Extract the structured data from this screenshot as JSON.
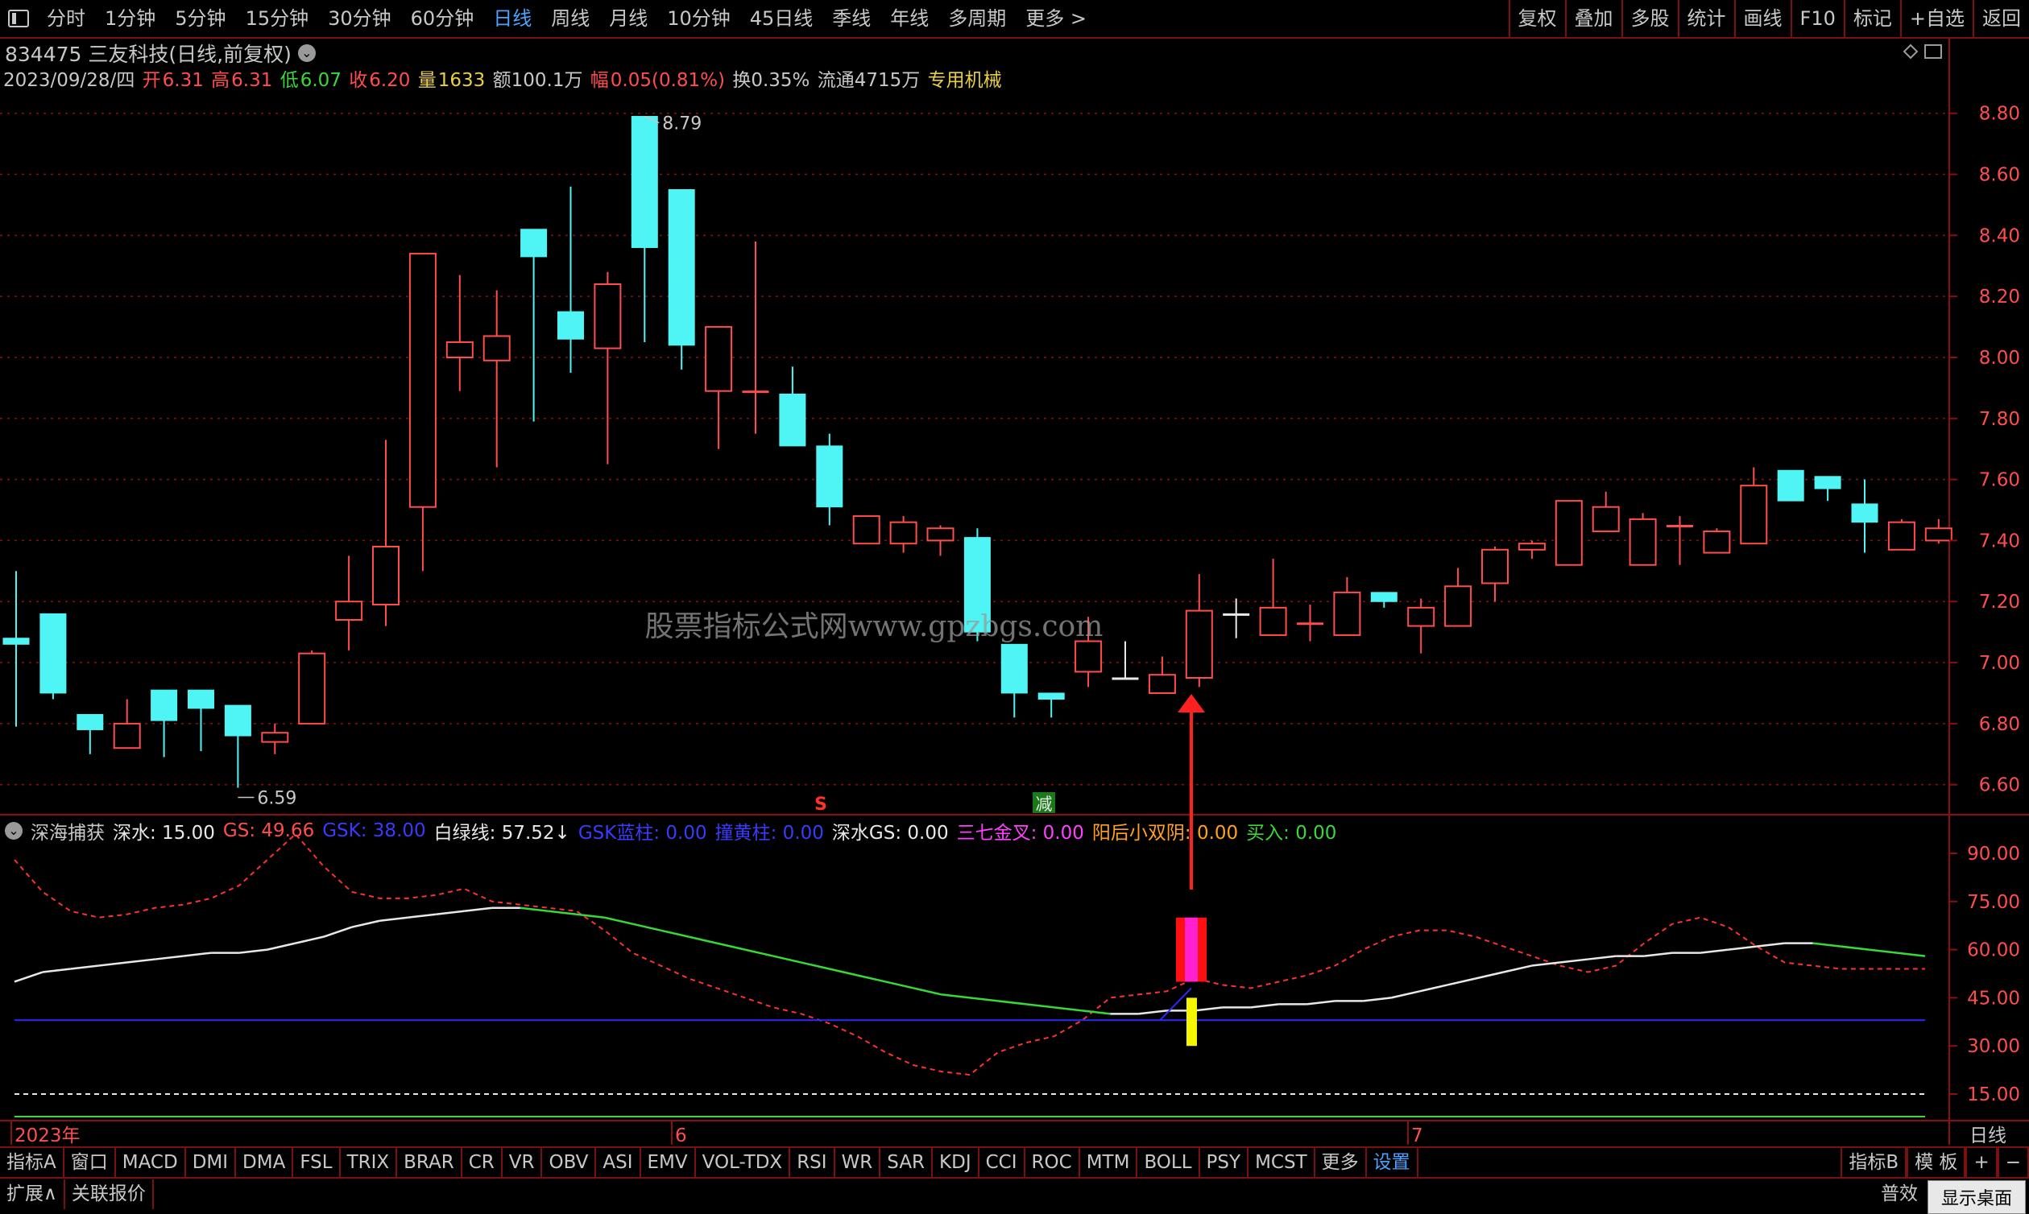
{
  "colors": {
    "up": "#ff4d4d",
    "down": "#4ff5f5",
    "grid": "#8a1010",
    "white": "#e8e8e8",
    "green": "#38d838",
    "blue": "#2a2aff"
  },
  "topbar": {
    "items": [
      "分时",
      "1分钟",
      "5分钟",
      "15分钟",
      "30分钟",
      "60分钟",
      "日线",
      "周线",
      "月线",
      "10分钟",
      "45日线",
      "季线",
      "年线",
      "多周期",
      "更多 >"
    ],
    "active_index": 6,
    "right_items": [
      "复权",
      "叠加",
      "多股",
      "统计",
      "画线",
      "F10",
      "标记",
      "+自选",
      "返回"
    ]
  },
  "stock": {
    "code_name": "834475 三友科技(日线,前复权)"
  },
  "info": {
    "date": "2023/09/28/四",
    "open_label": "开",
    "open": "6.31",
    "high_label": "高",
    "high": "6.31",
    "low_label": "低",
    "low": "6.07",
    "close_label": "收",
    "close": "6.20",
    "vol_label": "量",
    "vol": "1633",
    "amt": "额100.1万",
    "chg_label": "幅",
    "chg": "0.05(0.81%)",
    "turnover": "换0.35%",
    "float": "流通4715万",
    "industry": "专用机械"
  },
  "watermark": "股票指标公式网www.gpzbgs.com",
  "price_axis": [
    "8.80",
    "8.60",
    "8.40",
    "8.20",
    "8.00",
    "7.80",
    "7.60",
    "7.40",
    "7.20",
    "7.00",
    "6.80",
    "6.60"
  ],
  "price_marks": {
    "high": "8.79",
    "low": "6.59"
  },
  "signals": {
    "s": "S",
    "jian": "减"
  },
  "indicator": {
    "name": "深海捕获",
    "shenshui": "深水: 15.00",
    "gs": "GS: 49.66",
    "gsk": "GSK: 38.00",
    "bailv": "白绿线: 57.52↓",
    "gsk_lan": "GSK蓝柱: 0.00",
    "tan_huang": "撞黄柱: 0.00",
    "shenshui_gs": "深水GS: 0.00",
    "sanqi": "三七金叉: 0.00",
    "yanghou": "阳后小双阴: 0.00",
    "mairu": "买入: 0.00",
    "axis": [
      "90.00",
      "75.00",
      "60.00",
      "45.00",
      "30.00",
      "15.00"
    ]
  },
  "time_axis": {
    "labels": [
      "2023年",
      "6",
      "7"
    ],
    "right": "日线"
  },
  "tabs": [
    "指标A",
    "窗口",
    "MACD",
    "DMI",
    "DMA",
    "FSL",
    "TRIX",
    "BRAR",
    "CR",
    "VR",
    "OBV",
    "ASI",
    "EMV",
    "VOL-TDX",
    "RSI",
    "WR",
    "SAR",
    "KDJ",
    "CCI",
    "ROC",
    "MTM",
    "BOLL",
    "PSY",
    "MCST",
    "更多",
    "设置"
  ],
  "tabs_right": [
    "指标B",
    "模 板",
    "+",
    "−"
  ],
  "bottom": {
    "expand": "扩展∧",
    "related": "关联报价",
    "desktop": "显示桌面",
    "right_cut": "普效"
  },
  "chart_data": {
    "type": "candlestick",
    "ylim": [
      6.52,
      8.86
    ],
    "candles": [
      {
        "o": 7.08,
        "c": 7.06,
        "h": 7.3,
        "l": 6.79
      },
      {
        "o": 7.16,
        "c": 6.9,
        "h": 7.16,
        "l": 6.88
      },
      {
        "o": 6.83,
        "c": 6.78,
        "h": 6.83,
        "l": 6.7
      },
      {
        "o": 6.72,
        "c": 6.8,
        "h": 6.88,
        "l": 6.72
      },
      {
        "o": 6.91,
        "c": 6.81,
        "h": 6.91,
        "l": 6.69
      },
      {
        "o": 6.91,
        "c": 6.85,
        "h": 6.91,
        "l": 6.71
      },
      {
        "o": 6.86,
        "c": 6.76,
        "h": 6.86,
        "l": 6.59
      },
      {
        "o": 6.74,
        "c": 6.77,
        "h": 6.8,
        "l": 6.7
      },
      {
        "o": 6.8,
        "c": 7.03,
        "h": 7.04,
        "l": 6.8
      },
      {
        "o": 7.14,
        "c": 7.2,
        "h": 7.35,
        "l": 7.04
      },
      {
        "o": 7.19,
        "c": 7.38,
        "h": 7.73,
        "l": 7.12
      },
      {
        "o": 7.51,
        "c": 8.34,
        "h": 8.34,
        "l": 7.3
      },
      {
        "o": 8.0,
        "c": 8.05,
        "h": 8.27,
        "l": 7.89
      },
      {
        "o": 7.99,
        "c": 8.07,
        "h": 8.22,
        "l": 7.64
      },
      {
        "o": 8.42,
        "c": 8.33,
        "h": 8.42,
        "l": 7.79
      },
      {
        "o": 8.15,
        "c": 8.06,
        "h": 8.56,
        "l": 7.95
      },
      {
        "o": 8.03,
        "c": 8.24,
        "h": 8.28,
        "l": 7.65
      },
      {
        "o": 8.79,
        "c": 8.36,
        "h": 8.79,
        "l": 8.05
      },
      {
        "o": 8.55,
        "c": 8.04,
        "h": 8.55,
        "l": 7.96
      },
      {
        "o": 7.89,
        "c": 8.1,
        "h": 8.1,
        "l": 7.7
      },
      {
        "o": 7.89,
        "c": 7.89,
        "h": 8.38,
        "l": 7.75
      },
      {
        "o": 7.88,
        "c": 7.71,
        "h": 7.97,
        "l": 7.71
      },
      {
        "o": 7.71,
        "c": 7.51,
        "h": 7.75,
        "l": 7.45
      },
      {
        "o": 7.39,
        "c": 7.48,
        "h": 7.48,
        "l": 7.39
      },
      {
        "o": 7.39,
        "c": 7.46,
        "h": 7.48,
        "l": 7.36
      },
      {
        "o": 7.4,
        "c": 7.44,
        "h": 7.45,
        "l": 7.35
      },
      {
        "o": 7.41,
        "c": 7.1,
        "h": 7.44,
        "l": 7.07
      },
      {
        "o": 7.06,
        "c": 6.9,
        "h": 7.06,
        "l": 6.82
      },
      {
        "o": 6.9,
        "c": 6.88,
        "h": 6.9,
        "l": 6.82
      },
      {
        "o": 6.97,
        "c": 7.07,
        "h": 7.15,
        "l": 6.92
      },
      {
        "o": 6.95,
        "c": 6.95,
        "h": 7.07,
        "l": 6.95
      },
      {
        "o": 6.9,
        "c": 6.96,
        "h": 7.02,
        "l": 6.9
      },
      {
        "o": 6.95,
        "c": 7.17,
        "h": 7.29,
        "l": 6.92
      },
      {
        "o": 7.16,
        "c": 7.16,
        "h": 7.21,
        "l": 7.08
      },
      {
        "o": 7.09,
        "c": 7.18,
        "h": 7.34,
        "l": 7.09
      },
      {
        "o": 7.13,
        "c": 7.13,
        "h": 7.19,
        "l": 7.07
      },
      {
        "o": 7.09,
        "c": 7.23,
        "h": 7.28,
        "l": 7.09
      },
      {
        "o": 7.23,
        "c": 7.2,
        "h": 7.23,
        "l": 7.18
      },
      {
        "o": 7.12,
        "c": 7.18,
        "h": 7.21,
        "l": 7.03
      },
      {
        "o": 7.12,
        "c": 7.25,
        "h": 7.31,
        "l": 7.12
      },
      {
        "o": 7.26,
        "c": 7.37,
        "h": 7.38,
        "l": 7.2
      },
      {
        "o": 7.37,
        "c": 7.39,
        "h": 7.4,
        "l": 7.34
      },
      {
        "o": 7.32,
        "c": 7.53,
        "h": 7.53,
        "l": 7.32
      },
      {
        "o": 7.43,
        "c": 7.51,
        "h": 7.56,
        "l": 7.43
      },
      {
        "o": 7.32,
        "c": 7.47,
        "h": 7.49,
        "l": 7.32
      },
      {
        "o": 7.45,
        "c": 7.45,
        "h": 7.48,
        "l": 7.32
      },
      {
        "o": 7.36,
        "c": 7.43,
        "h": 7.44,
        "l": 7.36
      },
      {
        "o": 7.39,
        "c": 7.58,
        "h": 7.64,
        "l": 7.39
      },
      {
        "o": 7.63,
        "c": 7.53,
        "h": 7.63,
        "l": 7.53
      },
      {
        "o": 7.61,
        "c": 7.57,
        "h": 7.61,
        "l": 7.53
      },
      {
        "o": 7.52,
        "c": 7.46,
        "h": 7.6,
        "l": 7.36
      },
      {
        "o": 7.37,
        "c": 7.46,
        "h": 7.47,
        "l": 7.37
      },
      {
        "o": 7.4,
        "c": 7.44,
        "h": 7.47,
        "l": 7.39
      }
    ],
    "indicator_ylim": [
      0,
      100
    ],
    "white_green_line": [
      50,
      53,
      54,
      55,
      56,
      57,
      58,
      59,
      59,
      60,
      62,
      64,
      67,
      69,
      70,
      71,
      72,
      73,
      73,
      72,
      71,
      70,
      68,
      66,
      64,
      62,
      60,
      58,
      56,
      54,
      52,
      50,
      48,
      46,
      45,
      44,
      43,
      42,
      41,
      40,
      40,
      41,
      41,
      42,
      42,
      43,
      43,
      44,
      44,
      45,
      47,
      49,
      51,
      53,
      55,
      56,
      57,
      58,
      58,
      59,
      59,
      60,
      61,
      62,
      62,
      61,
      60,
      59,
      58
    ],
    "red_dash_line": [
      88,
      78,
      72,
      70,
      71,
      73,
      74,
      76,
      80,
      88,
      96,
      86,
      78,
      76,
      76,
      77,
      79,
      75,
      74,
      73,
      72,
      66,
      59,
      55,
      51,
      48,
      45,
      42,
      40,
      37,
      33,
      28,
      24,
      22,
      21,
      28,
      31,
      33,
      38,
      45,
      46,
      47,
      51,
      49,
      48,
      50,
      52,
      55,
      60,
      64,
      66,
      66,
      64,
      61,
      58,
      55,
      53,
      55,
      62,
      68,
      70,
      67,
      61,
      56,
      55,
      54,
      54,
      54,
      54
    ],
    "blue_line": 38,
    "white_dash_line": 15,
    "green_bottom_line": 2
  }
}
